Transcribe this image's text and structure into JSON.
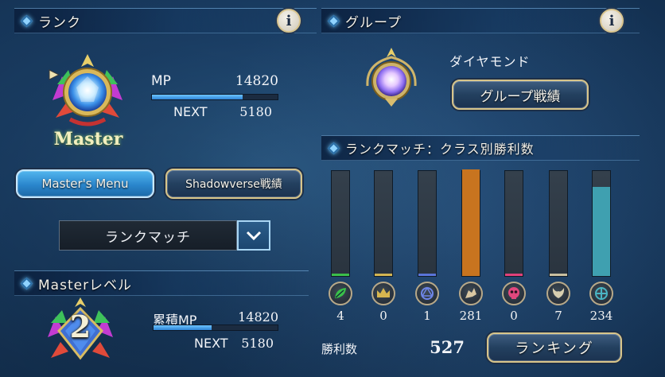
{
  "rank_section": {
    "title": "ランク",
    "rank_name": "Master",
    "mp_label": "MP",
    "mp_value": "14820",
    "mp_progress": 0.72,
    "next_label": "NEXT",
    "next_value": "5180",
    "masters_menu_label": "Master's Menu",
    "record_label": "Shadowverse戦績",
    "match_select_value": "ランクマッチ"
  },
  "master_level": {
    "title": "Masterレベル",
    "level": "2",
    "cumulative_label": "累積MP",
    "cumulative_value": "14820",
    "cumulative_progress": 0.47,
    "next_label": "NEXT",
    "next_value": "5180"
  },
  "group_section": {
    "title": "グループ",
    "group_name": "ダイヤモンド",
    "group_record_label": "グループ戦績"
  },
  "class_wins": {
    "title": "ランクマッチ：クラス別勝利数",
    "classes": [
      {
        "icon": "forestcraft-leaf-icon",
        "wins": "4",
        "value": 4,
        "color": "#3bbf4a"
      },
      {
        "icon": "swordcraft-crown-icon",
        "wins": "0",
        "value": 0,
        "color": "#d2b553"
      },
      {
        "icon": "runecraft-rune-icon",
        "wins": "1",
        "value": 1,
        "color": "#5a74d8"
      },
      {
        "icon": "dragoncraft-dragon-icon",
        "wins": "281",
        "value": 281,
        "color": "#c8741f"
      },
      {
        "icon": "shadowcraft-skull-icon",
        "wins": "0",
        "value": 0,
        "color": "#e0417a"
      },
      {
        "icon": "bloodcraft-wings-icon",
        "wins": "7",
        "value": 7,
        "color": "#c9bfa0"
      },
      {
        "icon": "havencraft-cross-icon",
        "wins": "234",
        "value": 234,
        "color": "#3fa0b0"
      }
    ],
    "scale_max": 281,
    "total_label": "勝利数",
    "total_value": "527",
    "ranking_label": "ランキング"
  }
}
